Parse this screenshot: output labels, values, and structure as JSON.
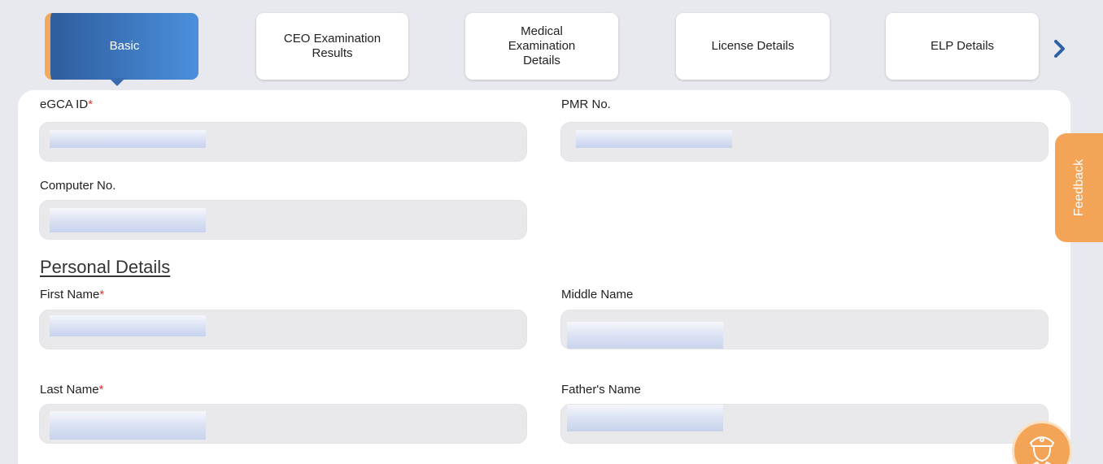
{
  "tabs": [
    {
      "label": "Basic",
      "active": true
    },
    {
      "label": "CEO Examination Results",
      "active": false
    },
    {
      "label": "Medical Examination Details",
      "active": false
    },
    {
      "label": "License Details",
      "active": false
    },
    {
      "label": "ELP Details",
      "active": false
    }
  ],
  "next_icon": "chevron-right-icon",
  "colors": {
    "active_tab_start": "#2f5d9d",
    "active_tab_end": "#4a8fdc",
    "active_tab_accent": "#f0a85a",
    "required_mark": "#d9373b",
    "feedback_bg": "#f3a456",
    "field_bg": "#e9e9ec",
    "page_bg": "#e8e9ee"
  },
  "form": {
    "egca_id_label": "eGCA ID",
    "pmr_no_label": "PMR No.",
    "computer_no_label": "Computer No.",
    "personal_details_title": "Personal Details",
    "first_name_label": "First Name",
    "middle_name_label": "Middle Name",
    "last_name_label": "Last Name",
    "fathers_name_label": "Father's Name",
    "required_mark": "*"
  },
  "feedback_label": "Feedback",
  "assistant_icon": "pilot-avatar-icon"
}
